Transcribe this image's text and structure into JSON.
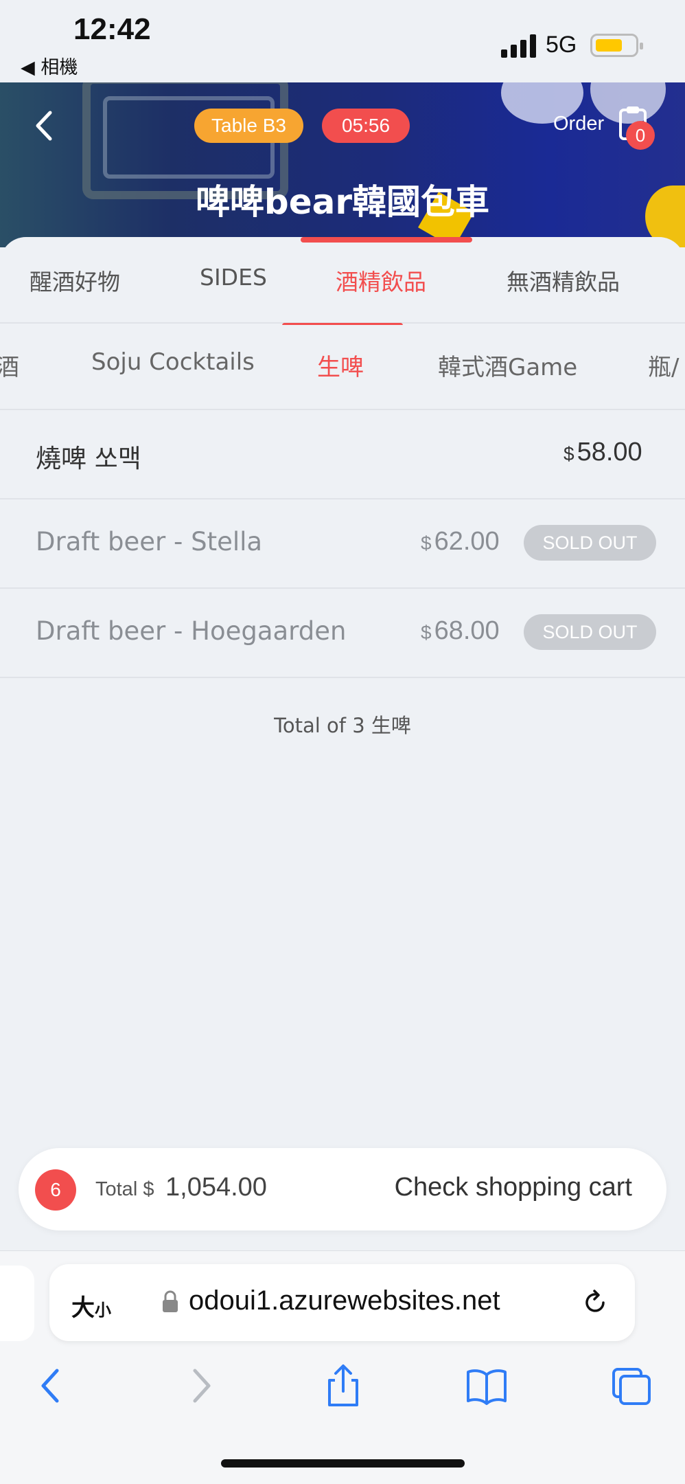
{
  "status_bar": {
    "time": "12:42",
    "back_app": "◀ 相機",
    "network": "5G"
  },
  "header": {
    "table_badge": "Table  B3",
    "timer": "05:56",
    "order_label": "Order",
    "order_count": "0",
    "store_title": "啤啤bear韓國包車"
  },
  "tabs": [
    {
      "label": "醒酒好物"
    },
    {
      "label": "SIDES"
    },
    {
      "label": "酒精飲品"
    },
    {
      "label": "無酒精飲品"
    }
  ],
  "subtabs": [
    {
      "label": "酒"
    },
    {
      "label": "Soju Cocktails"
    },
    {
      "label": "生啤"
    },
    {
      "label": "韓式酒Game"
    },
    {
      "label": "瓶/"
    }
  ],
  "items": [
    {
      "name": "燒啤 쏘맥",
      "currency": "$",
      "price": "58.00",
      "status": ""
    },
    {
      "name": "Draft beer - Stella",
      "currency": "$",
      "price": "62.00",
      "status": "SOLD OUT"
    },
    {
      "name": "Draft beer - Hoegaarden",
      "currency": "$",
      "price": "68.00",
      "status": "SOLD OUT"
    }
  ],
  "total_count": "Total of 3 生啤",
  "cart": {
    "count": "6",
    "total_label": "Total $",
    "total_value": "1,054.00",
    "check_label": "Check shopping cart"
  },
  "browser": {
    "text_size_big": "大",
    "text_size_small": "小",
    "url": "odoui1.azurewebsites.net"
  },
  "colors": {
    "accent": "#f24e4e",
    "table_badge": "#f7a531",
    "background": "#eef1f5"
  }
}
